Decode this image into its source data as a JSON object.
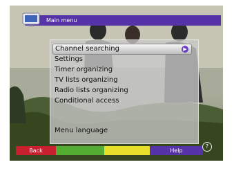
{
  "header": {
    "title": "Main menu"
  },
  "menu": {
    "items": [
      {
        "label": "Channel searching",
        "selected": true
      },
      {
        "label": "Settings"
      },
      {
        "label": "Timer organizing"
      },
      {
        "label": "TV lists organizing"
      },
      {
        "label": "Radio lists organizing"
      },
      {
        "label": "Conditional access"
      }
    ],
    "language_label": "Menu language"
  },
  "footer": {
    "back_label": "Back",
    "help_label": "Help",
    "colors": {
      "red": "#c8202f",
      "green": "#53ad32",
      "yellow": "#e7df2a",
      "purple": "#5733a8"
    }
  },
  "icons": {
    "header": "tv-icon",
    "selected_item": "arrow-right-icon",
    "help": "help-icon"
  }
}
